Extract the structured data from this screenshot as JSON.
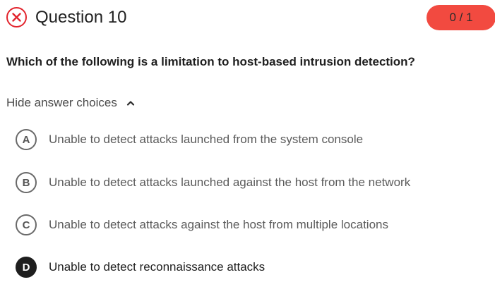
{
  "header": {
    "status_icon": "close-circle-icon",
    "status_color": "#e2242d",
    "title": "Question 10",
    "score": "0 / 1",
    "score_color": "#f24a40"
  },
  "question": {
    "text": "Which of the following is a limitation to host-based intrusion detection?"
  },
  "answers_toggle": {
    "label": "Hide answer choices",
    "icon": "chevron-up-icon"
  },
  "choices": [
    {
      "letter": "A",
      "text": "Unable to detect attacks launched from the system console",
      "selected": false
    },
    {
      "letter": "B",
      "text": "Unable to detect attacks launched against the host from the network",
      "selected": false
    },
    {
      "letter": "C",
      "text": "Unable to detect attacks against the host from multiple locations",
      "selected": false
    },
    {
      "letter": "D",
      "text": "Unable to detect reconnaissance attacks",
      "selected": true
    }
  ]
}
